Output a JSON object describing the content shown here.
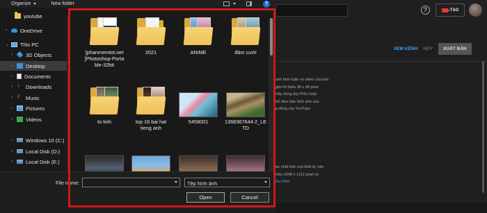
{
  "toolbar": {
    "organize_label": "Organize",
    "new_folder_label": "New folder",
    "help_glyph": "?"
  },
  "nav": {
    "items": [
      {
        "label": "youtube",
        "icon": "folder-icon"
      },
      {
        "label": "OneDrive",
        "icon": "cloud-icon"
      },
      {
        "label": "This PC",
        "icon": "computer-icon"
      },
      {
        "label": "3D Objects",
        "icon": "cube-icon"
      },
      {
        "label": "Desktop",
        "icon": "desktop-icon",
        "selected": true
      },
      {
        "label": "Documents",
        "icon": "document-icon"
      },
      {
        "label": "Downloads",
        "icon": "download-icon"
      },
      {
        "label": "Music",
        "icon": "music-icon"
      },
      {
        "label": "Pictures",
        "icon": "pictures-icon"
      },
      {
        "label": "Videos",
        "icon": "video-icon"
      },
      {
        "label": "Windows 10 (C:)",
        "icon": "drive-icon"
      },
      {
        "label": "Local Disk (D:)",
        "icon": "drive-icon"
      },
      {
        "label": "Local Disk (E:)",
        "icon": "drive-icon"
      }
    ]
  },
  "files": [
    {
      "label": "[phanmemtot.net\n]Photoshop-Porta\nble-32bit",
      "kind": "folder"
    },
    {
      "label": "2021",
      "kind": "folder"
    },
    {
      "label": "ANIME",
      "kind": "folder"
    },
    {
      "label": "đám cưới",
      "kind": "folder"
    },
    {
      "label": "to tinh",
      "kind": "folder"
    },
    {
      "label": "top 16 bai hat\ntieng anh",
      "kind": "folder"
    },
    {
      "label": "5458001",
      "kind": "image"
    },
    {
      "label": "1368367644-2_LE\nTD",
      "kind": "image"
    },
    {
      "label": "",
      "kind": "image"
    },
    {
      "label": "",
      "kind": "image"
    },
    {
      "label": "",
      "kind": "image"
    },
    {
      "label": "",
      "kind": "image"
    }
  ],
  "bottom": {
    "file_name_label": "File name:",
    "file_name_value": "",
    "file_type_value": "Tệp hình ảnh",
    "open_label": "Open",
    "cancel_label": "Cancel"
  },
  "youtube": {
    "create_label": "TẠO",
    "help_glyph": "?",
    "view_channel_label": "XEM KÊNH",
    "cancel_label": "HỦY",
    "publish_label": "XUẤT BẢN",
    "info_lines": [
      "anh bình luận và video của bạn",
      "giải tối thiểu 98 x 98 pixel",
      "Hãy dùng tệp PNG hoặc",
      "hể đảm bảo hình ảnh của",
      "g đồng của YouTube"
    ],
    "info_lines_2": [
      "ào nhất trên mọi thiết bị, hãy",
      "hiểu 2048 x 1152 pixel và",
      "nếu thêm"
    ],
    "link_text": "iều thêm"
  },
  "colors": {
    "highlight": "#d4161c",
    "folder": "#eec05a",
    "accent_link": "#3ea6ff"
  }
}
